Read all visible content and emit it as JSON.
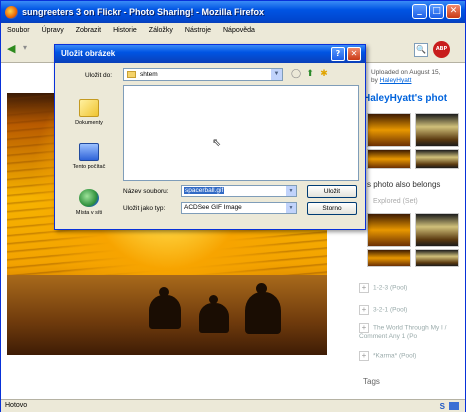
{
  "window": {
    "title": "sungreeters 3 on Flickr - Photo Sharing! - Mozilla Firefox",
    "min_glyph": "_",
    "max_glyph": "□",
    "close_glyph": "✕"
  },
  "menubar": {
    "items": [
      "Soubor",
      "Úpravy",
      "Zobrazit",
      "Historie",
      "Záložky",
      "Nástroje",
      "Nápověda"
    ]
  },
  "toolbar": {
    "search_icon_glyph": "🔍",
    "abp_label": "ABP"
  },
  "sidebar": {
    "uploaded_text": "Uploaded on August 15,",
    "by_prefix": "by",
    "owner_link": "HaleyHyatt",
    "owner_photos_title": "HaleyHyatt's phot",
    "belongs_text": "s photo also belongs",
    "explored_text": "Explored (Set)",
    "pools": [
      {
        "label": "1-2-3 (Pool)"
      },
      {
        "label": "3-2-1 (Pool)"
      },
      {
        "label": "The World Through My I / Comment Any 1 (Po"
      },
      {
        "label": "*Karma* (Pool)"
      }
    ],
    "tags_label": "Tags"
  },
  "statusbar": {
    "text": "Hotovo",
    "right_label": "S"
  },
  "dialog": {
    "title": "Uložit obrázek",
    "help_glyph": "?",
    "close_glyph": "✕",
    "lookin_label": "Uložit do:",
    "lookin_value": "shtem",
    "places": [
      "Dokumenty",
      "Tento počítač",
      "Místa v síti"
    ],
    "filename_label": "Název souboru:",
    "filename_value": "spacerball.gif",
    "filetype_label": "Uložit jako typ:",
    "filetype_value": "ACDSee GIF Image",
    "save_label": "Uložit",
    "cancel_label": "Storno"
  },
  "colors": {
    "titlebar_blue": "#0054e3",
    "flickr_link": "#0063dc",
    "selection": "#316ac5"
  }
}
